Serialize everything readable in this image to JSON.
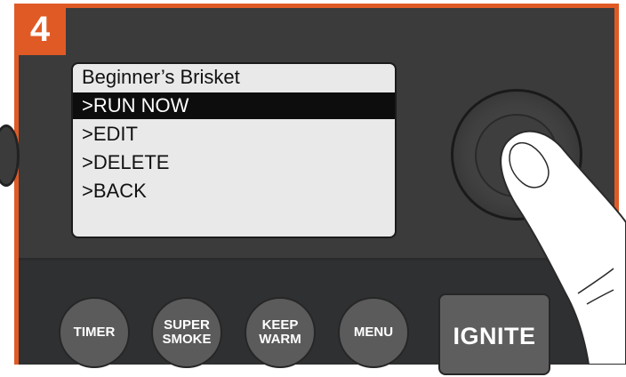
{
  "step": {
    "number": "4"
  },
  "screen": {
    "title": "Beginner’s Brisket",
    "items": [
      {
        "label": ">RUN NOW",
        "selected": true
      },
      {
        "label": ">EDIT",
        "selected": false
      },
      {
        "label": ">DELETE",
        "selected": false
      },
      {
        "label": ">BACK",
        "selected": false
      }
    ]
  },
  "buttons": {
    "timer": "TIMER",
    "super_smoke_line1": "SUPER",
    "super_smoke_line2": "SMOKE",
    "keep_warm_line1": "KEEP",
    "keep_warm_line2": "WARM",
    "menu": "MENU",
    "ignite": "IGNITE"
  },
  "colors": {
    "accent": "#e05a26",
    "panel": "#3b3b3c",
    "screen_bg": "#e9e9e9",
    "selected_row": "#0d0d0d"
  },
  "icons": {
    "knob": "selection-dial-icon",
    "hand": "pressing-finger-icon"
  }
}
